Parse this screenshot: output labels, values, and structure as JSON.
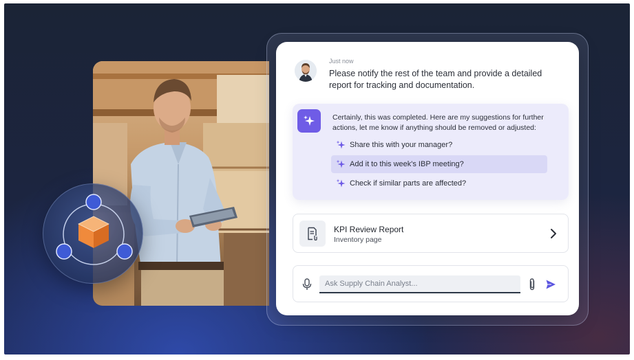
{
  "chat": {
    "timestamp": "Just now",
    "user_message": "Please notify the rest of the team and provide a detailed report for tracking and documentation.",
    "ai_message": "Certainly, this was completed. Here are my suggestions for further actions, let me know if anything should be removed or adjusted:",
    "suggestions": [
      {
        "label": "Share this with your manager?",
        "icon": "sparkle-icon"
      },
      {
        "label": "Add it to this week's IBP meeting?",
        "icon": "sparkle-icon",
        "active": true
      },
      {
        "label": "Check if similar parts are affected?",
        "icon": "sparkle-icon"
      }
    ]
  },
  "kpi_card": {
    "title": "KPI Review Report",
    "subtitle": "Inventory page",
    "icon": "document-icon"
  },
  "composer": {
    "placeholder": "Ask Supply Chain Analyst...",
    "value": ""
  },
  "colors": {
    "accent": "#6f5ce6",
    "suggestion_bg": "#ecebfb",
    "active_row": "#d9d8f6",
    "orbit_node": "#3f5bd6",
    "cube_orange": "#f08a3c"
  }
}
